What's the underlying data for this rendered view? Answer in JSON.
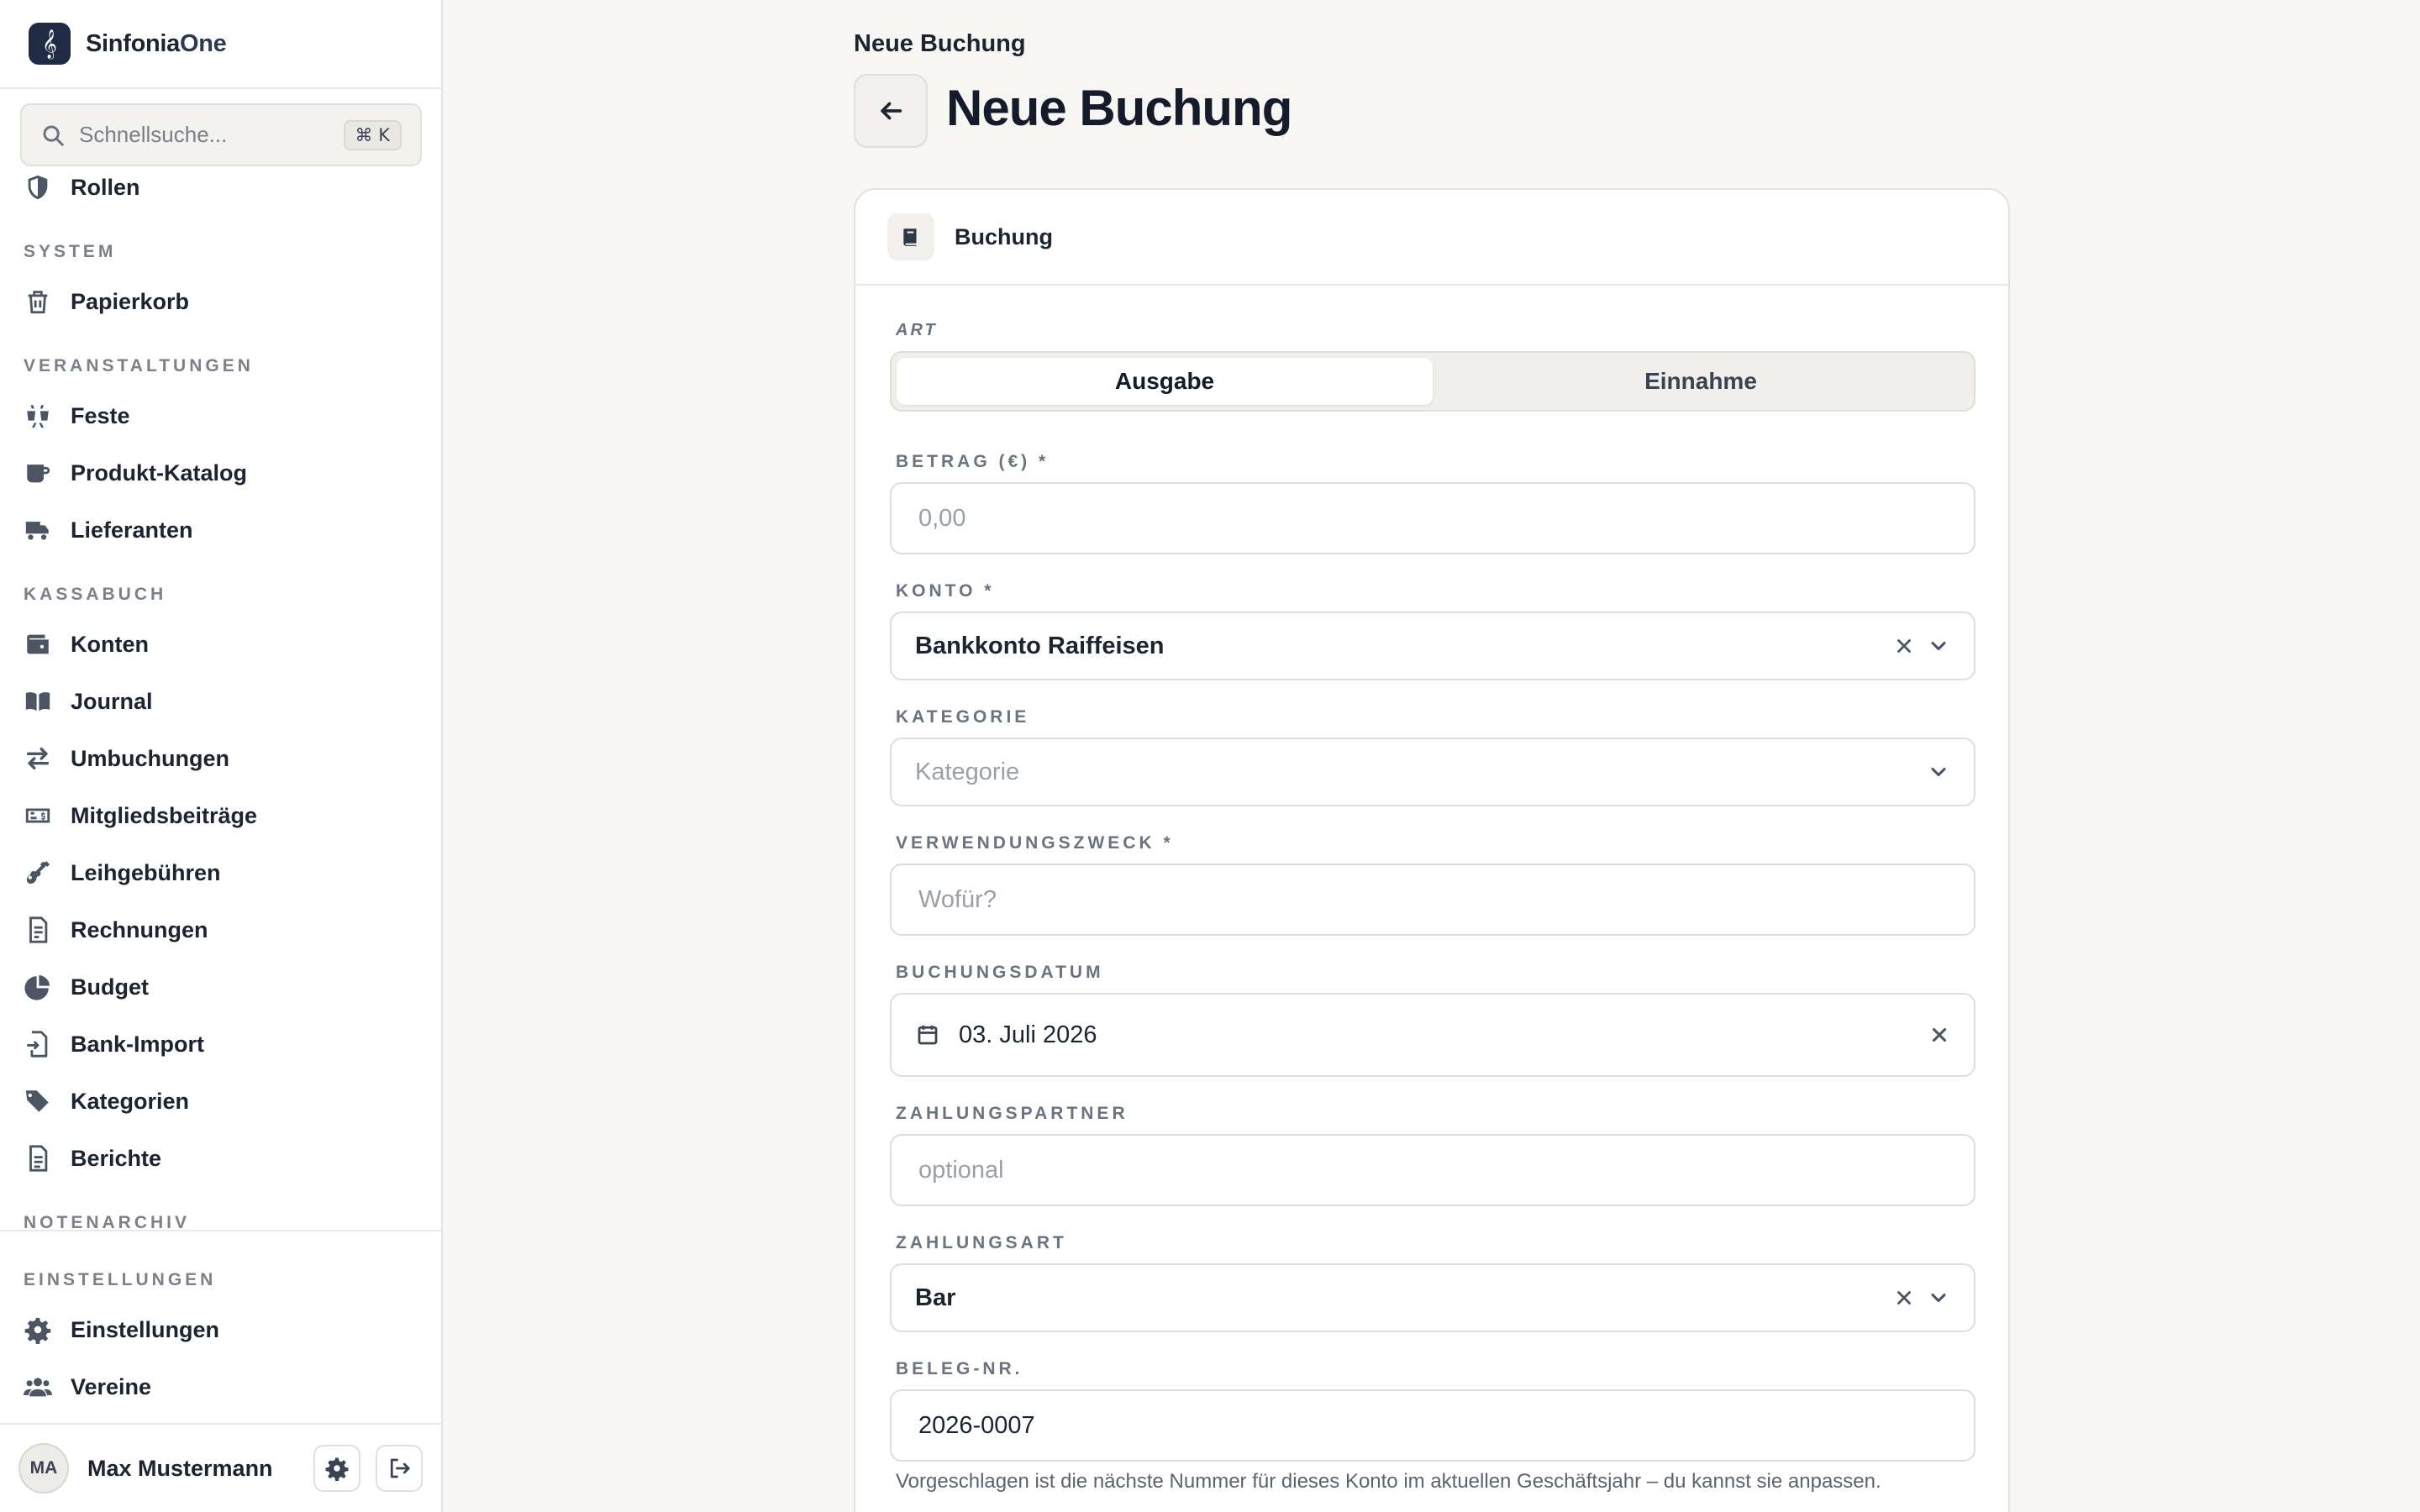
{
  "brand": {
    "name_main": "Sinfonia",
    "name_suffix": "One",
    "logo_glyph": "𝄞"
  },
  "search": {
    "placeholder": "Schnellsuche...",
    "shortcut": "⌘ K"
  },
  "nav": {
    "top_item": {
      "label": "Rollen",
      "icon": "shield-icon"
    },
    "sections": [
      {
        "title": "SYSTEM",
        "items": [
          {
            "label": "Papierkorb",
            "icon": "trash-icon"
          }
        ]
      },
      {
        "title": "VERANSTALTUNGEN",
        "items": [
          {
            "label": "Feste",
            "icon": "party-icon"
          },
          {
            "label": "Produkt-Katalog",
            "icon": "mug-icon"
          },
          {
            "label": "Lieferanten",
            "icon": "truck-icon"
          }
        ]
      },
      {
        "title": "KASSABUCH",
        "items": [
          {
            "label": "Konten",
            "icon": "wallet-icon"
          },
          {
            "label": "Journal",
            "icon": "book-open-icon"
          },
          {
            "label": "Umbuchungen",
            "icon": "transfer-icon"
          },
          {
            "label": "Mitgliedsbeiträge",
            "icon": "money-bill-icon"
          },
          {
            "label": "Leihgebühren",
            "icon": "guitar-icon"
          },
          {
            "label": "Rechnungen",
            "icon": "invoice-icon"
          },
          {
            "label": "Budget",
            "icon": "pie-chart-icon"
          },
          {
            "label": "Bank-Import",
            "icon": "file-import-icon"
          },
          {
            "label": "Kategorien",
            "icon": "tags-icon"
          },
          {
            "label": "Berichte",
            "icon": "report-icon"
          }
        ]
      },
      {
        "title": "NOTENARCHIV",
        "items": []
      }
    ],
    "bottom": {
      "title": "EINSTELLUNGEN",
      "items": [
        {
          "label": "Einstellungen",
          "icon": "gear-icon"
        },
        {
          "label": "Vereine",
          "icon": "users-icon"
        }
      ]
    }
  },
  "user": {
    "initials": "MA",
    "name": "Max Mustermann"
  },
  "page": {
    "breadcrumb": "Neue Buchung",
    "title": "Neue Buchung"
  },
  "form": {
    "card_title": "Buchung",
    "art": {
      "label": "ART",
      "options": [
        "Ausgabe",
        "Einnahme"
      ],
      "selected": "Ausgabe"
    },
    "betrag": {
      "label": "BETRAG (€) *",
      "placeholder": "0,00"
    },
    "konto": {
      "label": "KONTO *",
      "value": "Bankkonto Raiffeisen"
    },
    "kategorie": {
      "label": "KATEGORIE",
      "placeholder": "Kategorie"
    },
    "verwendungszweck": {
      "label": "VERWENDUNGSZWECK *",
      "placeholder": "Wofür?"
    },
    "buchungsdatum": {
      "label": "BUCHUNGSDATUM",
      "value": "03. Juli 2026"
    },
    "zahlungspartner": {
      "label": "ZAHLUNGSPARTNER",
      "placeholder": "optional"
    },
    "zahlungsart": {
      "label": "ZAHLUNGSART",
      "value": "Bar"
    },
    "beleg": {
      "label": "BELEG-NR.",
      "value": "2026-0007",
      "helper": "Vorgeschlagen ist die nächste Nummer für dieses Konto im aktuellen Geschäftsjahr – du kannst sie anpassen."
    }
  }
}
